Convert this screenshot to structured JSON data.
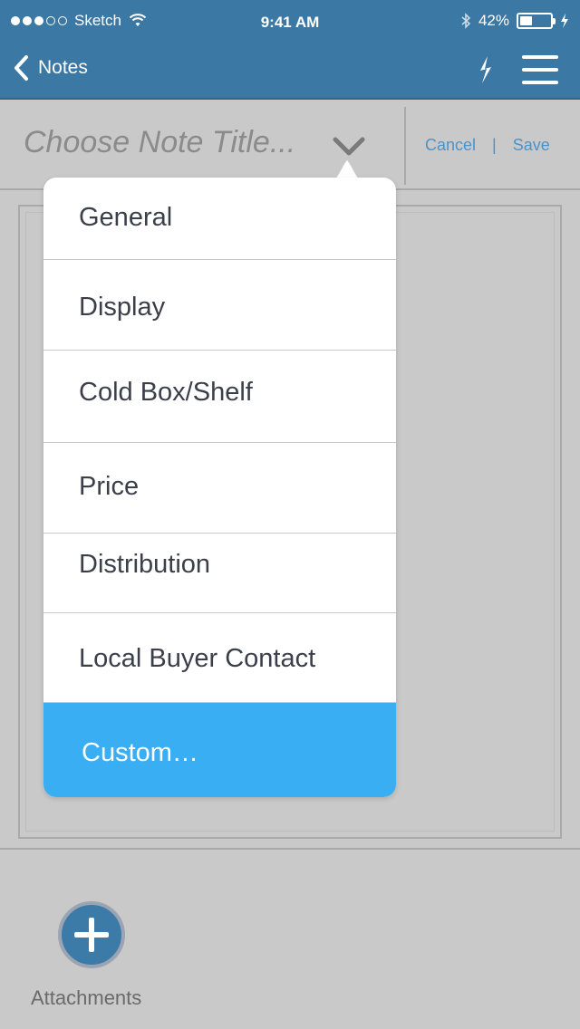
{
  "status_bar": {
    "carrier": "Sketch",
    "time": "9:41 AM",
    "battery_percent": "42%",
    "battery_level": 0.42,
    "icons": [
      "signal-dots",
      "wifi-icon",
      "bluetooth-icon",
      "battery-icon",
      "charging-bolt-icon"
    ]
  },
  "nav": {
    "back_label": "Notes",
    "icons": [
      "chevron-left-icon",
      "lightning-icon",
      "hamburger-menu-icon"
    ]
  },
  "titlebar": {
    "placeholder": "Choose Note Title...",
    "cancel_label": "Cancel",
    "separator": "|",
    "save_label": "Save"
  },
  "dropdown": {
    "options": [
      {
        "label": "General"
      },
      {
        "label": "Display"
      },
      {
        "label": "Cold Box/Shelf"
      },
      {
        "label": "Price"
      },
      {
        "label": "Distribution"
      },
      {
        "label": "Local Buyer Contact"
      },
      {
        "label": "Custom…"
      }
    ],
    "selected_index": 6
  },
  "attachments": {
    "label": "Attachments"
  },
  "colors": {
    "nav_bg": "#3b78a3",
    "accent_blue": "#4a93c9",
    "selected_bg": "#3aaef3",
    "page_bg": "#c9c9c9"
  }
}
